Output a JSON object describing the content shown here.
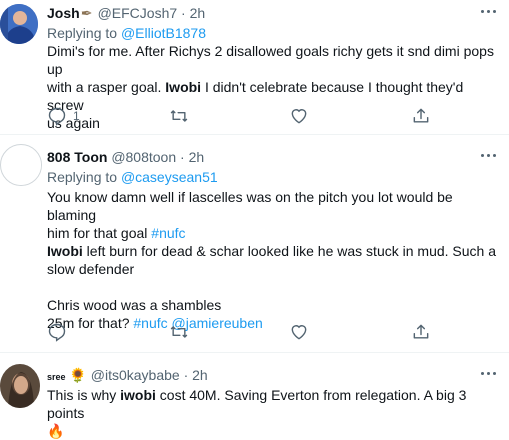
{
  "tweets": [
    {
      "name": "Josh",
      "handle": "@EFCJosh7",
      "separator": "·",
      "time": "2h",
      "replying_prefix": "Replying to ",
      "replying_to": "@ElliotB1878",
      "text_line1": "Dimi's for me. After Richys 2 disallowed goals richy gets it snd dimi pops up",
      "text_line2_a": "with a rasper goal. ",
      "text_line2_bold": "Iwobi",
      "text_line2_b": " I didn't celebrate because I thought they'd screw",
      "text_line3": "us again",
      "reply_count": "1",
      "avatar_icon": "profile-photo"
    },
    {
      "name": "808 Toon",
      "handle": "@808toon",
      "separator": "·",
      "time": "2h",
      "replying_prefix": "Replying to ",
      "replying_to": "@caseysean51",
      "text_line1": "You know damn well if lascelles was on the pitch you lot would be blaming",
      "text_line2": "him for that goal ",
      "text_line2_hashtag": "#nufc",
      "text_line3_bold": "Iwobi",
      "text_line3": " left burn for dead & schar looked like he was stuck in mud. Such a",
      "text_line4": "slow defender",
      "text_line5": "Chris wood was a shambles",
      "text_line6": "25m for that? ",
      "text_line6_hashtag": "#nufc",
      "text_line6_mention": "@jamiereuben",
      "avatar_icon": "default-avatar"
    },
    {
      "name": "sree",
      "name_emoji": "🌻",
      "handle": "@its0kaybabe",
      "separator": "·",
      "time": "2h",
      "text_a": "This is why ",
      "text_bold": "iwobi",
      "text_b": " cost 40M. Saving Everton from relegation. A big 3 points",
      "text_emoji": "🔥",
      "avatar_icon": "profile-photo"
    }
  ],
  "colors": {
    "text": "#0f1419",
    "secondary": "#536471",
    "link": "#1d9bf0",
    "divider": "#eff3f4"
  }
}
